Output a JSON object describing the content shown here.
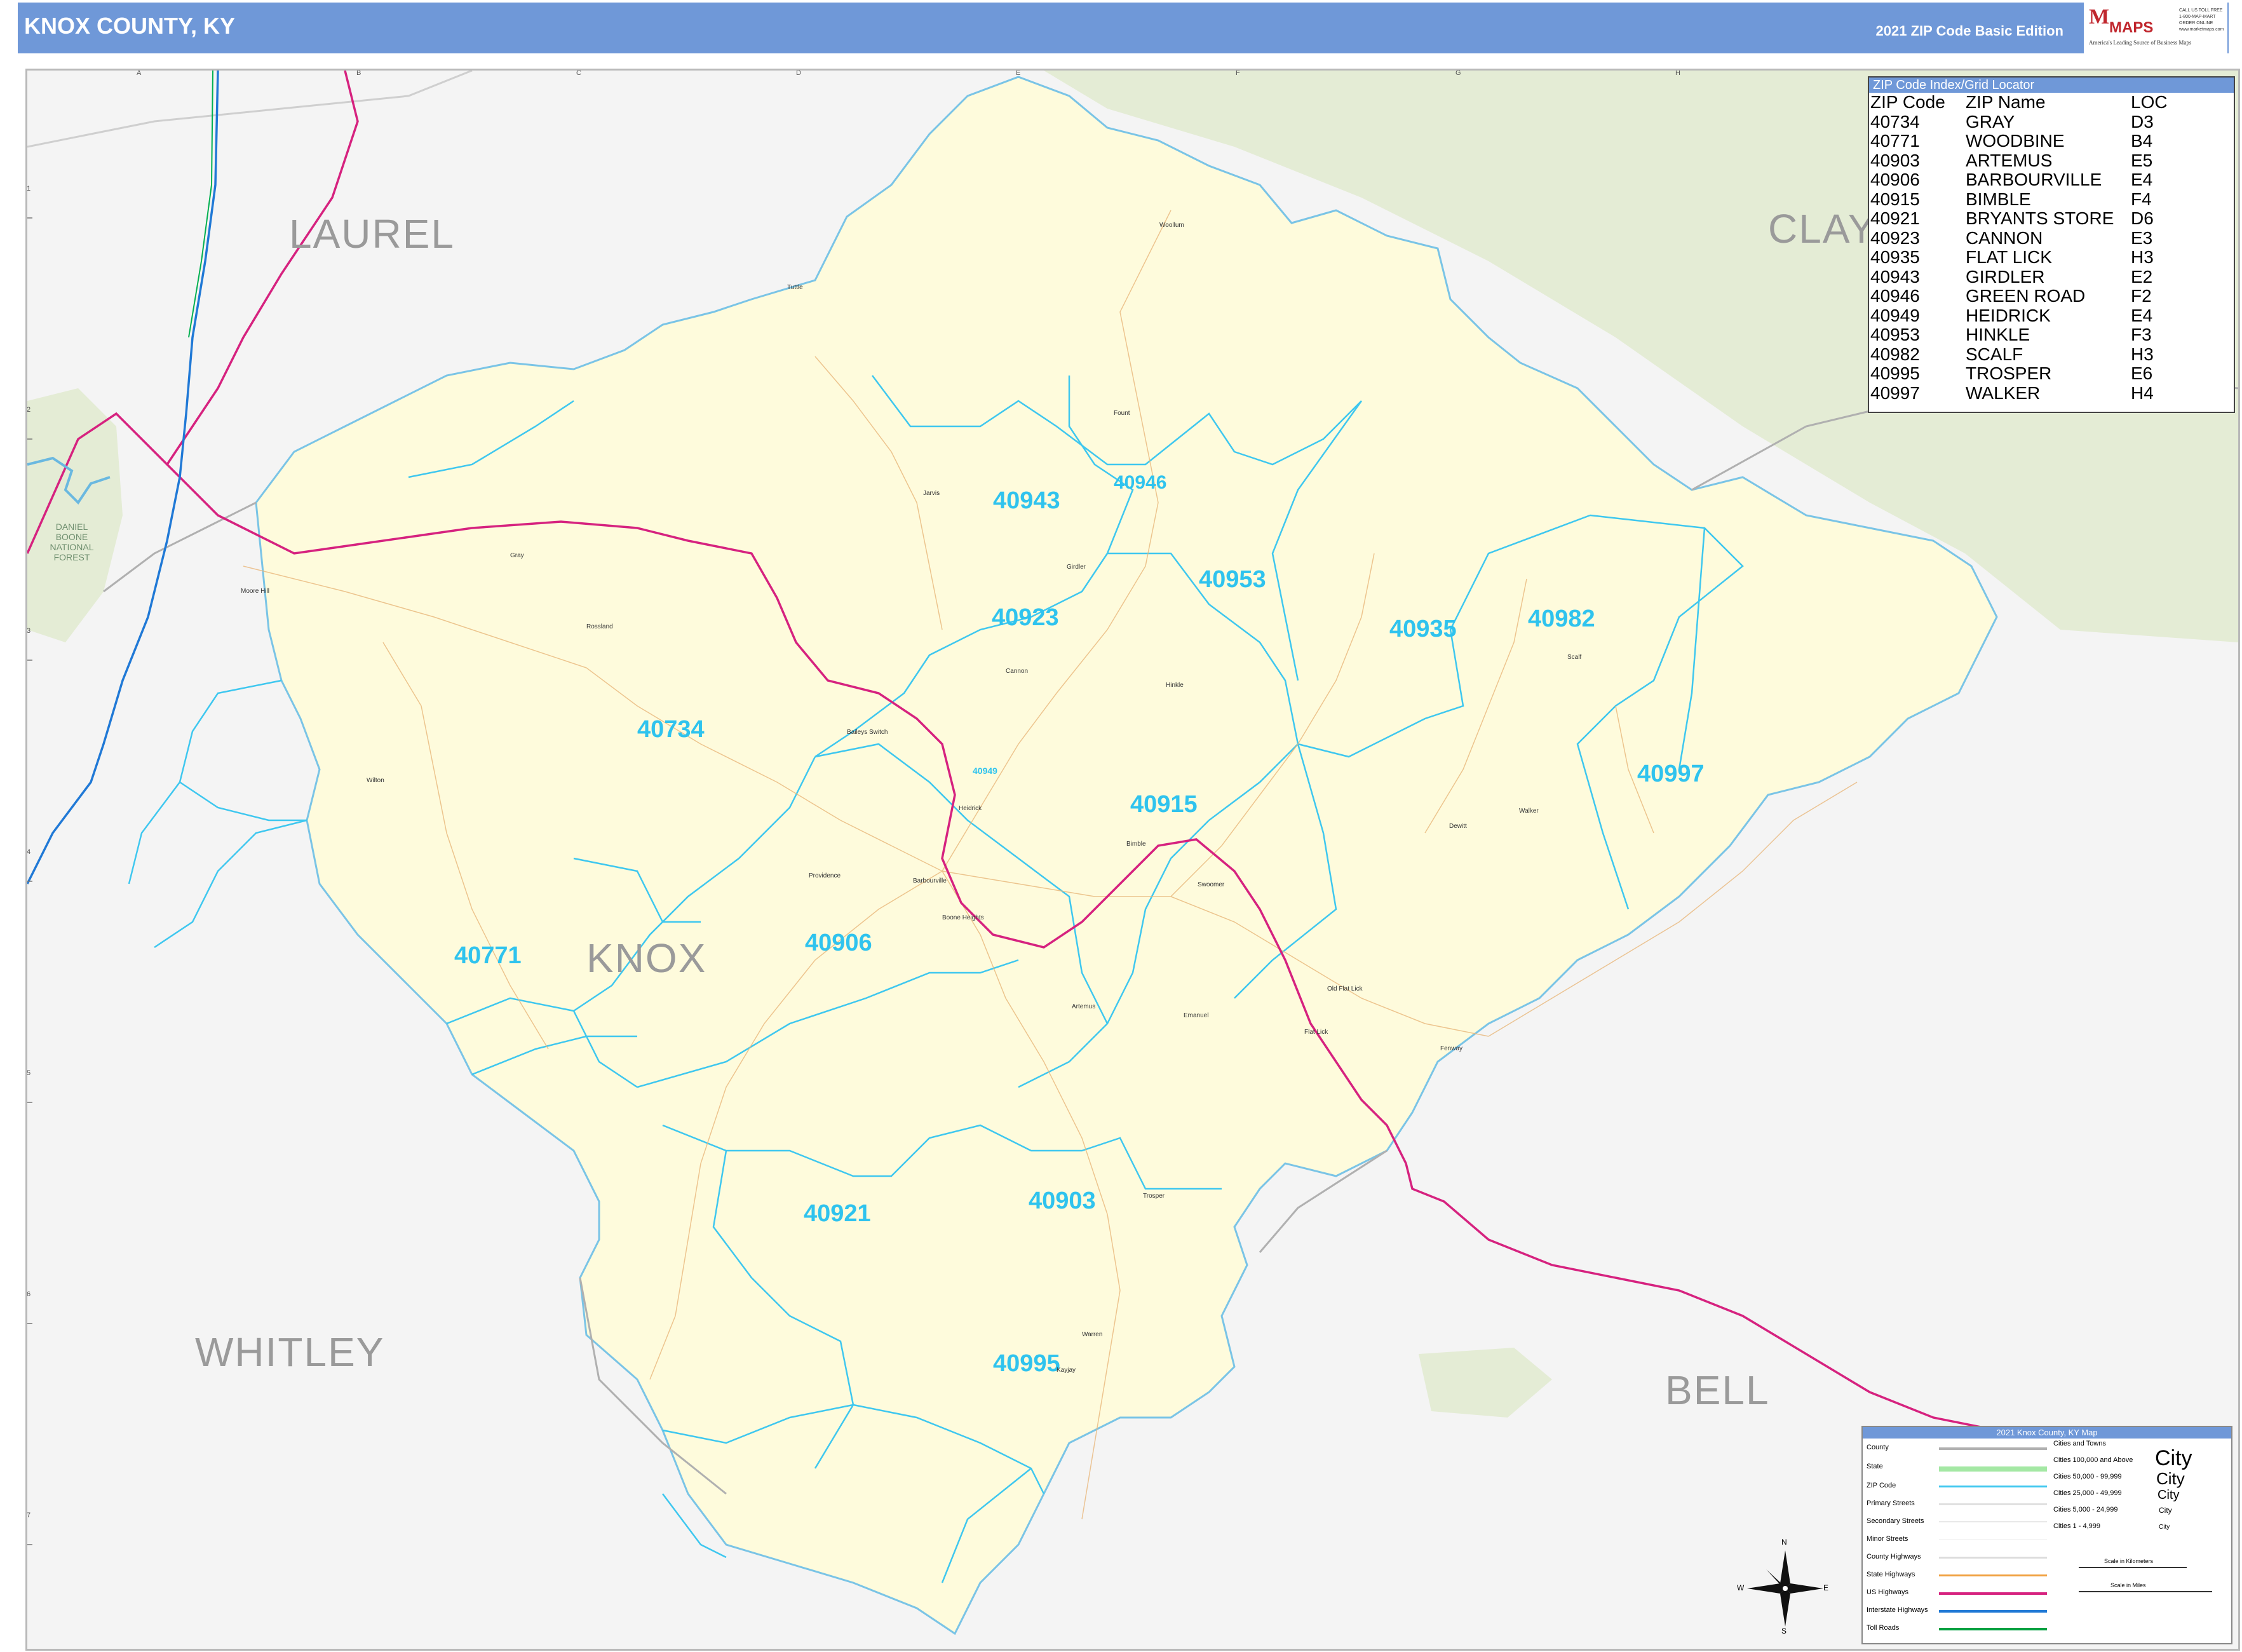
{
  "header": {
    "title": "KNOX COUNTY, KY",
    "edition": "2021 ZIP Code Basic Edition",
    "logo_letter": "M",
    "logo_word": "MAPS",
    "logo_tagline": "America's Leading Source of Business Maps",
    "logo_contact": "CALL US TOLL FREE 1-800-MAP-MART ORDER ONLINE www.marketmaps.com"
  },
  "colors": {
    "header_bg": "#6f98d8",
    "county_fill": "#fefbdc",
    "neighbor_fill": "#f4f4f4",
    "forest_fill": "#e4ecd5",
    "zip_boundary": "#3ec7ef",
    "us_highway": "#d6227f",
    "interstate": "#2079d6",
    "county_border": "#b0b0b0"
  },
  "grid": {
    "columns": [
      "A",
      "B",
      "C",
      "D",
      "E",
      "F",
      "G",
      "H"
    ],
    "rows": [
      "1",
      "2",
      "3",
      "4",
      "5",
      "6",
      "7"
    ]
  },
  "counties": {
    "laurel": "LAUREL",
    "clay": "CLAY",
    "knox": "KNOX",
    "whitley": "WHITLEY",
    "bell": "BELL"
  },
  "forest_label": "DANIEL BOONE NATIONAL FOREST",
  "zip_labels": [
    "40943",
    "40946",
    "40953",
    "40935",
    "40982",
    "40923",
    "40734",
    "40997",
    "40915",
    "40906",
    "40771",
    "40921",
    "40903",
    "40995"
  ],
  "zip_small_label": "40949",
  "places": [
    "Woollum",
    "Tuttle",
    "Fount",
    "Jarvis",
    "Girdler",
    "Gray",
    "Rossland",
    "Cannon",
    "Hinkle",
    "Baileys Switch",
    "Heidrick",
    "Bimble",
    "Barbourville",
    "Providence",
    "Boone Heights",
    "Swoomer",
    "Scalf",
    "Walker",
    "Dewitt",
    "Artemus",
    "Wilton",
    "Moore Hill",
    "Emanuel",
    "Old Flat Lick",
    "Flat Lick",
    "Fenway",
    "Trosper",
    "Warren",
    "Kayjay"
  ],
  "zip_index": {
    "title": "ZIP Code Index/Grid Locator",
    "headers": [
      "ZIP Code",
      "ZIP Name",
      "LOC"
    ],
    "rows": [
      [
        "40734",
        "GRAY",
        "D3"
      ],
      [
        "40771",
        "WOODBINE",
        "B4"
      ],
      [
        "40903",
        "ARTEMUS",
        "E5"
      ],
      [
        "40906",
        "BARBOURVILLE",
        "E4"
      ],
      [
        "40915",
        "BIMBLE",
        "F4"
      ],
      [
        "40921",
        "BRYANTS STORE",
        "D6"
      ],
      [
        "40923",
        "CANNON",
        "E3"
      ],
      [
        "40935",
        "FLAT LICK",
        "H3"
      ],
      [
        "40943",
        "GIRDLER",
        "E2"
      ],
      [
        "40946",
        "GREEN ROAD",
        "F2"
      ],
      [
        "40949",
        "HEIDRICK",
        "E4"
      ],
      [
        "40953",
        "HINKLE",
        "F3"
      ],
      [
        "40982",
        "SCALF",
        "H3"
      ],
      [
        "40995",
        "TROSPER",
        "E6"
      ],
      [
        "40997",
        "WALKER",
        "H4"
      ]
    ]
  },
  "legend": {
    "title": "2021 Knox County, KY Map",
    "items": [
      "County",
      "State",
      "ZIP Code",
      "Primary Streets",
      "Secondary Streets",
      "Minor Streets",
      "County Highways",
      "State Highways",
      "US Highways",
      "Interstate Highways",
      "Toll Roads"
    ],
    "cities_title": "Cities and Towns",
    "cities": [
      "Cities 100,000 and Above",
      "Cities 50,000 - 99,999",
      "Cities 25,000 - 49,999",
      "Cities 5,000 - 24,999",
      "Cities 1 - 4,999"
    ],
    "city_symbol": "City",
    "scale_km": "Scale in Kilometers",
    "scale_mi": "Scale in Miles"
  },
  "compass": {
    "n": "N",
    "s": "S",
    "e": "E",
    "w": "W"
  }
}
